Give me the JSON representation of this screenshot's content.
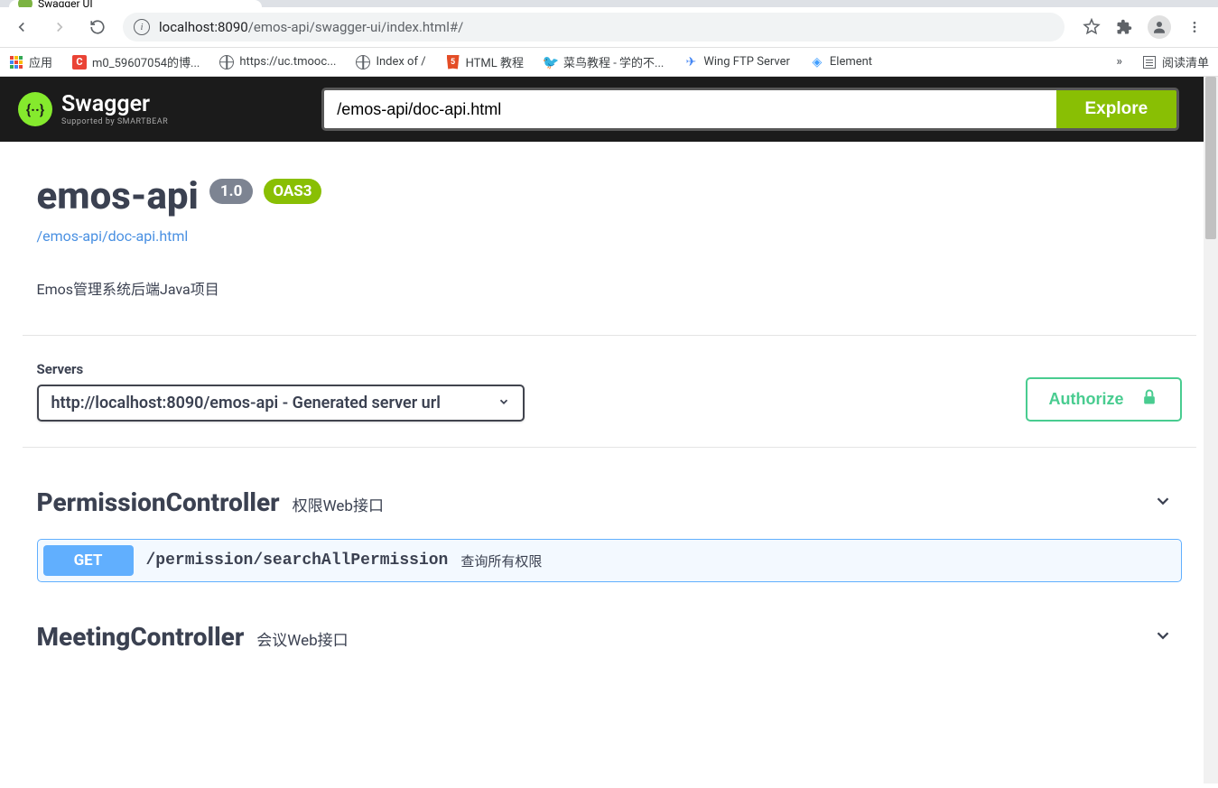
{
  "browserTab": {
    "title": "Swagger UI"
  },
  "url": {
    "host": "localhost:8090",
    "path": "/emos-api/swagger-ui/index.html#/"
  },
  "bookmarks": {
    "apps": "应用",
    "items": [
      "m0_59607054的博...",
      "https://uc.tmooc...",
      "Index of /",
      "HTML 教程",
      "菜鸟教程 - 学的不...",
      "Wing FTP Server",
      "Element"
    ],
    "readingList": "阅读清单"
  },
  "swagger": {
    "logoText": "Swagger",
    "logoSub": "Supported by SMARTBEAR",
    "searchValue": "/emos-api/doc-api.html",
    "exploreLabel": "Explore"
  },
  "api": {
    "title": "emos-api",
    "version": "1.0",
    "oas": "OAS3",
    "link": "/emos-api/doc-api.html",
    "description": "Emos管理系统后端Java项目"
  },
  "servers": {
    "label": "Servers",
    "selected": "http://localhost:8090/emos-api - Generated server url"
  },
  "authorize": {
    "label": "Authorize"
  },
  "controllers": [
    {
      "name": "PermissionController",
      "desc": "权限Web接口",
      "endpoints": [
        {
          "method": "GET",
          "path": "/permission/searchAllPermission",
          "desc": "查询所有权限"
        }
      ]
    },
    {
      "name": "MeetingController",
      "desc": "会议Web接口",
      "endpoints": []
    }
  ]
}
